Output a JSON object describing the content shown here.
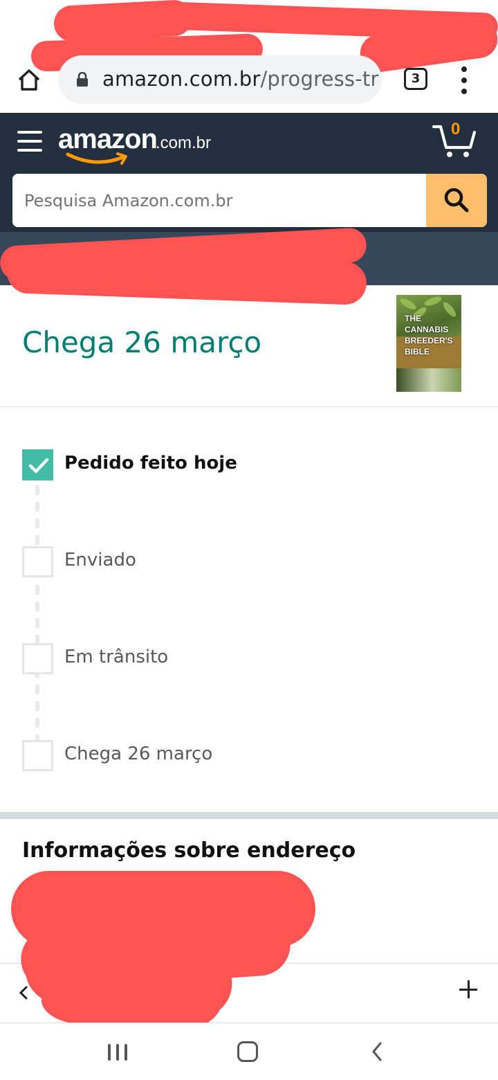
{
  "browser": {
    "url_domain": "amazon.com.br",
    "url_path": "/progress-tra",
    "tab_count": "3",
    "icons": [
      "home-icon",
      "lock-icon",
      "overflow-menu-icon",
      "plus-icon",
      "back-chevron-icon"
    ]
  },
  "header": {
    "logo_text": "amazon",
    "logo_tld": ".com.br",
    "cart_count": "0",
    "search_placeholder": "Pesquisa Amazon.com.br",
    "colors": {
      "header_bg": "#232f3e",
      "subnav_bg": "#37475a",
      "search_button": "#febd69",
      "cart_count": "#ff9900"
    }
  },
  "delivery": {
    "arrival_title": "Chega 26 março",
    "title_color": "#007e71",
    "product_image": {
      "title_lines": [
        "THE",
        "CANNABIS",
        "BREEDER'S",
        "BIBLE"
      ]
    }
  },
  "tracking": {
    "steps": [
      {
        "label": "Pedido feito hoje",
        "done": true
      },
      {
        "label": "Enviado",
        "done": false
      },
      {
        "label": "Em trânsito",
        "done": false
      },
      {
        "label": "Chega 26 março",
        "done": false
      }
    ],
    "done_color": "#42bda5"
  },
  "address": {
    "section_title": "Informações sobre endereço"
  },
  "system_nav": {
    "icons": [
      "recents-icon",
      "home-icon",
      "back-icon"
    ]
  }
}
